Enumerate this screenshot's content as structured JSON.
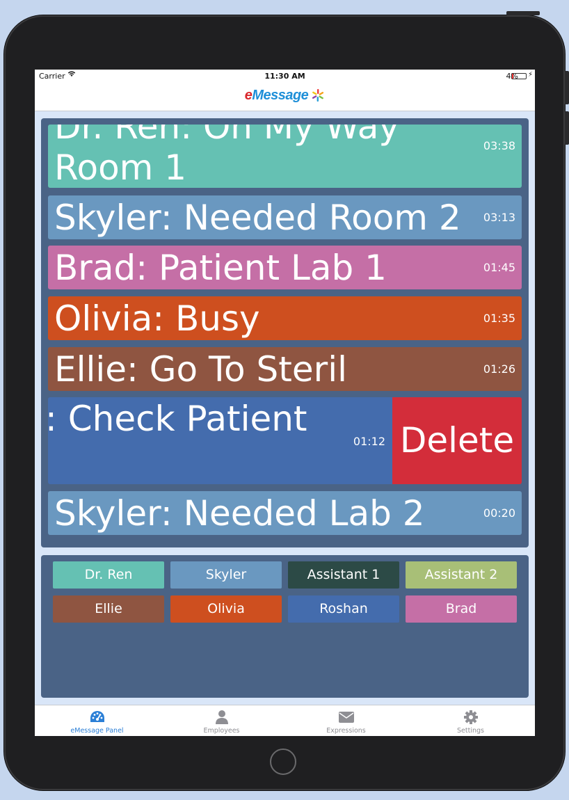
{
  "status_bar": {
    "carrier": "Carrier",
    "time": "11:30 AM",
    "battery": "4%"
  },
  "app": {
    "logo_e": "e",
    "logo_rest": "Message"
  },
  "messages": [
    {
      "line1": "Dr. Ren: On My Way",
      "line2": "Room 1",
      "time": "03:38",
      "color": "#65c1b3"
    },
    {
      "text": "Skyler: Needed Room 2",
      "time": "03:13",
      "color": "#6a98c0"
    },
    {
      "text": "Brad: Patient Lab 1",
      "time": "01:45",
      "color": "#c56fa6"
    },
    {
      "text": "Olivia: Busy",
      "time": "01:35",
      "color": "#ce4f1f"
    },
    {
      "text": "Ellie: Go To Steril",
      "time": "01:26",
      "color": "#8f5541"
    },
    {
      "text": ": Check Patient",
      "time": "01:12",
      "color": "#446cad",
      "swipe_action": "Delete"
    },
    {
      "text": "Skyler: Needed Lab 2",
      "time": "00:20",
      "color": "#6a98c0"
    }
  ],
  "staff": [
    {
      "name": "Dr. Ren",
      "color": "#65c1b3"
    },
    {
      "name": "Skyler",
      "color": "#6a98c0"
    },
    {
      "name": "Assistant 1",
      "color": "#2c4a46"
    },
    {
      "name": "Assistant 2",
      "color": "#a8bf77"
    },
    {
      "name": "Ellie",
      "color": "#8f5541"
    },
    {
      "name": "Olivia",
      "color": "#ce4f1f"
    },
    {
      "name": "Roshan",
      "color": "#446cad"
    },
    {
      "name": "Brad",
      "color": "#c56fa6"
    }
  ],
  "tabs": [
    {
      "label": "eMessage Panel",
      "icon": "dashboard-icon",
      "active": true
    },
    {
      "label": "Employees",
      "icon": "person-icon",
      "active": false
    },
    {
      "label": "Expressions",
      "icon": "envelope-icon",
      "active": false
    },
    {
      "label": "Settings",
      "icon": "gear-icon",
      "active": false
    }
  ],
  "colors": {
    "panel_bg": "#4a6386",
    "delete": "#d32d3a",
    "active_tab": "#2b7fd6"
  }
}
